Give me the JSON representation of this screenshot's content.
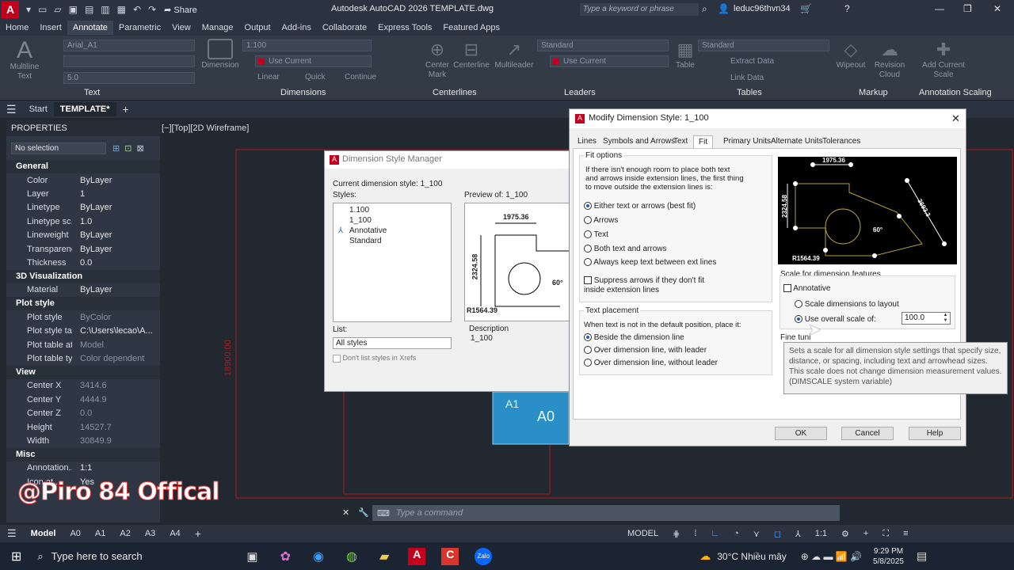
{
  "title_bar": {
    "window_title": "Autodesk AutoCAD 2026   TEMPLATE.dwg",
    "share_label": "Share",
    "search_placeholder": "Type a keyword or phrase",
    "username": "leduc96thvn34"
  },
  "ribbon_tabs": [
    "Home",
    "Insert",
    "Annotate",
    "Parametric",
    "View",
    "Manage",
    "Output",
    "Add-ins",
    "Collaborate",
    "Express Tools",
    "Featured Apps"
  ],
  "ribbon": {
    "text_panel": {
      "title": "Text",
      "multiline": "Multiline Text",
      "font": "Arial_A1",
      "height": "5.0"
    },
    "dimensions_panel": {
      "title": "Dimensions",
      "dimension": "Dimension",
      "style": "1:100",
      "layer": "Use Current",
      "linear": "Linear",
      "quick": "Quick",
      "continue": "Continue"
    },
    "centerlines_panel": {
      "title": "Centerlines",
      "center_mark": "Center Mark",
      "centerline": "Centerline"
    },
    "leaders_panel": {
      "title": "Leaders",
      "multileader": "Multileader",
      "style": "Standard",
      "layer": "Use Current"
    },
    "tables_panel": {
      "title": "Tables",
      "table": "Table",
      "style": "Standard",
      "extract": "Extract Data",
      "link": "Link Data"
    },
    "markup_panel": {
      "title": "Markup",
      "wipeout": "Wipeout",
      "revision": "Revision Cloud"
    },
    "scaling_panel": {
      "title": "Annotation Scaling",
      "add_scale": "Add Current Scale"
    }
  },
  "file_tabs": {
    "start": "Start",
    "active": "TEMPLATE*"
  },
  "viewport_label": "[−][Top][2D Wireframe]",
  "properties": {
    "title": "PROPERTIES",
    "selection": "No selection",
    "sections": [
      {
        "name": "General",
        "rows": [
          [
            "Color",
            "ByLayer"
          ],
          [
            "Layer",
            "1"
          ],
          [
            "Linetype",
            "ByLayer"
          ],
          [
            "Linetype sc...",
            "1.0"
          ],
          [
            "Lineweight",
            "ByLayer"
          ],
          [
            "Transparency",
            "ByLayer"
          ],
          [
            "Thickness",
            "0.0"
          ]
        ]
      },
      {
        "name": "3D Visualization",
        "rows": [
          [
            "Material",
            "ByLayer"
          ]
        ]
      },
      {
        "name": "Plot style",
        "rows": [
          [
            "Plot style",
            "ByColor"
          ],
          [
            "Plot style ta...",
            "C:\\Users\\lecao\\A..."
          ],
          [
            "Plot table at...",
            "Model"
          ],
          [
            "Plot table ty...",
            "Color dependent"
          ]
        ]
      },
      {
        "name": "View",
        "rows": [
          [
            "Center X",
            "3414.6"
          ],
          [
            "Center Y",
            "4444.9"
          ],
          [
            "Center Z",
            "0.0"
          ],
          [
            "Height",
            "14527.7"
          ],
          [
            "Width",
            "30849.9"
          ]
        ]
      },
      {
        "name": "Misc",
        "rows": [
          [
            "Annotation...",
            "1:1"
          ],
          [
            "Icon at...",
            "Yes"
          ]
        ]
      }
    ]
  },
  "dsm": {
    "title": "Dimension Style Manager",
    "current": "Current dimension style: 1_100",
    "styles_label": "Styles:",
    "styles": [
      "1.100",
      "1_100",
      "Annotative",
      "Standard"
    ],
    "preview_label": "Preview of: 1_100",
    "list_label": "List:",
    "list_value": "All styles",
    "xref_label": "Don't list styles in Xrefs",
    "description_label": "Description",
    "description_value": "1_100",
    "preview_dims": {
      "top": "1975.36",
      "left": "2324.58",
      "radius": "R1564.39",
      "angle": "60°"
    }
  },
  "mds": {
    "title": "Modify Dimension Style: 1_100",
    "tabs": [
      "Lines",
      "Symbols and Arrows",
      "Text",
      "Fit",
      "Primary Units",
      "Alternate Units",
      "Tolerances"
    ],
    "fit_options": {
      "title": "Fit options",
      "description": "If there isn't enough room to place both text and arrows inside extension lines, the first thing to move outside the extension lines is:",
      "options": [
        "Either text or arrows (best fit)",
        "Arrows",
        "Text",
        "Both text and arrows",
        "Always keep text between ext lines"
      ],
      "suppress": "Suppress arrows if they don't fit inside extension lines"
    },
    "text_placement": {
      "title": "Text placement",
      "description": "When text is not in the default position, place it:",
      "options": [
        "Beside the dimension line",
        "Over dimension line, with leader",
        "Over dimension line, without leader"
      ]
    },
    "scale": {
      "title": "Scale for dimension features",
      "annotative": "Annotative",
      "layout": "Scale dimensions to layout",
      "overall": "Use overall scale of:",
      "value": "100.0"
    },
    "fine_tuning": "Fine tuni",
    "preview_dims": {
      "top": "1975.36",
      "left": "2324.58",
      "right": "3693.3",
      "angle": "60°",
      "radius": "R1564.39"
    },
    "tooltip": "Sets a scale for all dimension style settings that specify size, distance, or spacing, including text and arrowhead sizes. This scale does not change dimension measurement values. (DIMSCALE system variable)",
    "buttons": {
      "ok": "OK",
      "cancel": "Cancel",
      "help": "Help"
    }
  },
  "drawing": {
    "block_labels": [
      "A1",
      "A0"
    ],
    "dim_text": "18900.00"
  },
  "command_placeholder": "Type a command",
  "layout_tabs": [
    "Model",
    "A0",
    "A1",
    "A2",
    "A3",
    "A4"
  ],
  "status": {
    "model": "MODEL",
    "scale": "1:1"
  },
  "taskbar": {
    "search": "Type here to search",
    "weather": "30°C  Nhiều mây",
    "time": "9:29 PM",
    "date": "5/8/2025"
  },
  "watermark": "@Piro 84 Offical",
  "colors": {
    "accent": "#c4001d",
    "selection": "#1a5fb4"
  }
}
